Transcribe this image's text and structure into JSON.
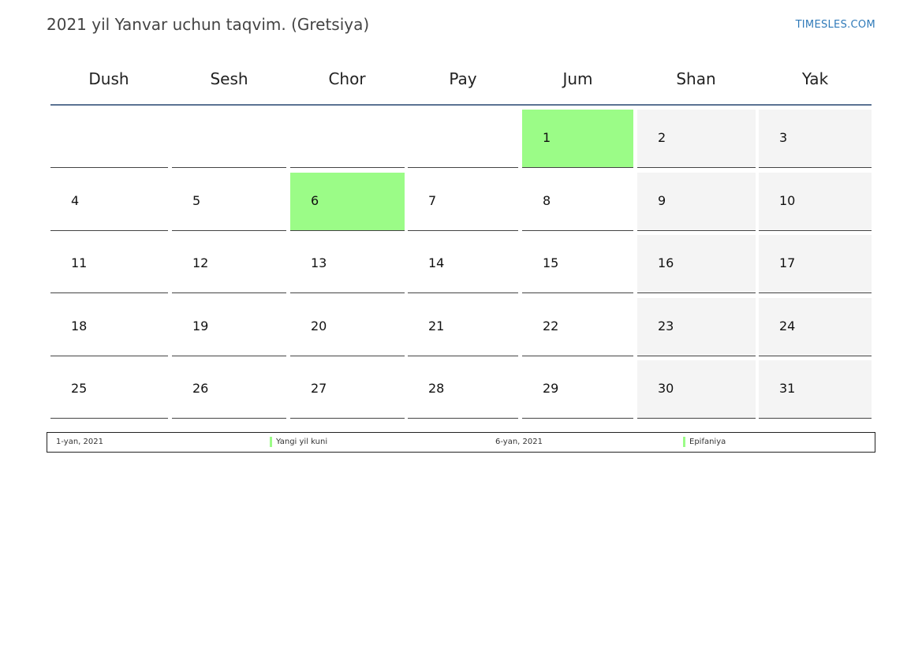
{
  "header": {
    "title": "2021 yil Yanvar uchun taqvim. (Gretsiya)",
    "site": "TIMESLES.COM"
  },
  "weekdays": [
    "Dush",
    "Sesh",
    "Chor",
    "Pay",
    "Jum",
    "Shan",
    "Yak"
  ],
  "calendar": {
    "weeks": [
      [
        "",
        "",
        "",
        "",
        "1",
        "2",
        "3"
      ],
      [
        "4",
        "5",
        "6",
        "7",
        "8",
        "9",
        "10"
      ],
      [
        "11",
        "12",
        "13",
        "14",
        "15",
        "16",
        "17"
      ],
      [
        "18",
        "19",
        "20",
        "21",
        "22",
        "23",
        "24"
      ],
      [
        "25",
        "26",
        "27",
        "28",
        "29",
        "30",
        "31"
      ]
    ],
    "holidays": [
      "1",
      "6"
    ],
    "weekend_columns": [
      5,
      6
    ]
  },
  "legend": [
    {
      "date": "1-yan, 2021",
      "name": "Yangi yil kuni"
    },
    {
      "date": "6-yan, 2021",
      "name": "Epifaniya"
    }
  ],
  "colors": {
    "holiday": "#9bfc87",
    "weekend": "#f4f4f4",
    "header_rule": "#5b7393",
    "link": "#2f7ab9"
  }
}
